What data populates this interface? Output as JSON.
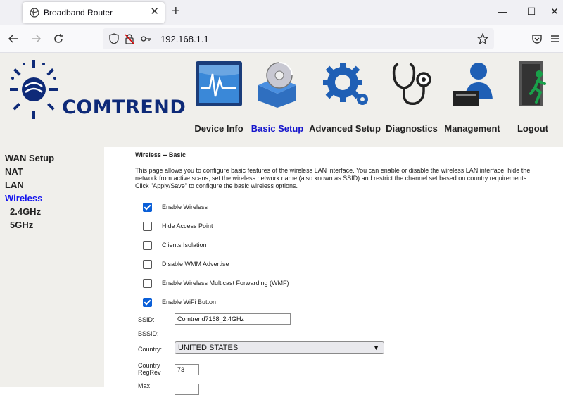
{
  "browser": {
    "tab_title": "Broadband Router",
    "tab_close": "✕",
    "new_tab": "+",
    "url": "192.168.1.1",
    "window_buttons": [
      "—",
      "☐",
      "✕"
    ]
  },
  "header": {
    "logo_text": "COMTREND",
    "nav": [
      {
        "label": "Device Info",
        "icon": "device-info-icon"
      },
      {
        "label": "Basic Setup",
        "icon": "basic-setup-icon",
        "active": true
      },
      {
        "label": "Advanced Setup",
        "icon": "gear-icon"
      },
      {
        "label": "Diagnostics",
        "icon": "stethoscope-icon"
      },
      {
        "label": "Management",
        "icon": "management-icon"
      },
      {
        "label": "Logout",
        "icon": "logout-icon"
      }
    ]
  },
  "sidebar": {
    "items": [
      {
        "label": "WAN Setup"
      },
      {
        "label": "NAT"
      },
      {
        "label": "LAN"
      },
      {
        "label": "Wireless",
        "active": true
      },
      {
        "label": "2.4GHz"
      },
      {
        "label": "5GHz"
      }
    ]
  },
  "main": {
    "title": "Wireless -- Basic",
    "description": "This page allows you to configure basic features of the wireless LAN interface. You can enable or disable the wireless LAN interface, hide the network from active scans, set the wireless network name (also known as SSID) and restrict the channel set based on country requirements. Click \"Apply/Save\" to configure the basic wireless options.",
    "checkboxes": [
      {
        "label": "Enable Wireless",
        "checked": true
      },
      {
        "label": "Hide Access Point",
        "checked": false
      },
      {
        "label": "Clients Isolation",
        "checked": false
      },
      {
        "label": "Disable WMM Advertise",
        "checked": false
      },
      {
        "label": "Enable Wireless Multicast Forwarding (WMF)",
        "checked": false
      },
      {
        "label": "Enable WiFi Button",
        "checked": true
      }
    ],
    "ssid_label": "SSID:",
    "ssid_value": "Comtrend7168_2.4GHz",
    "bssid_label": "BSSID:",
    "country_label": "Country:",
    "country_value": "UNITED STATES",
    "country_regrev_label": "Country RegRev",
    "country_regrev_value": "73",
    "max_label": "Max",
    "max_value": "",
    "colors": {
      "accent": "#1515cc",
      "checkbox": "#0a5fd8",
      "logo": "#0e2a78",
      "page_bg": "#f0efeb"
    }
  }
}
